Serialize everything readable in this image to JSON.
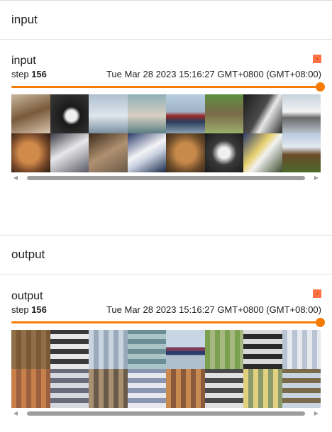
{
  "sections": [
    {
      "header": "input",
      "card": {
        "title": "input",
        "step_label": "step",
        "step_value": "156",
        "timestamp": "Tue Mar 28 2023 15:16:27 GMT+0800 (GMT+08:00)",
        "slider_position": 1.0,
        "swatch_color": "#ff7043"
      }
    },
    {
      "header": "output",
      "card": {
        "title": "output",
        "step_label": "step",
        "step_value": "156",
        "timestamp": "Tue Mar 28 2023 15:16:27 GMT+0800 (GMT+08:00)",
        "slider_position": 1.0,
        "swatch_color": "#ff7043"
      }
    }
  ],
  "colors": {
    "accent": "#f57c00",
    "swatch": "#ff7043",
    "scroll_thumb": "#9e9e9e"
  },
  "icons": {
    "scroll_left": "triangle-left-icon",
    "scroll_right": "triangle-right-icon"
  }
}
